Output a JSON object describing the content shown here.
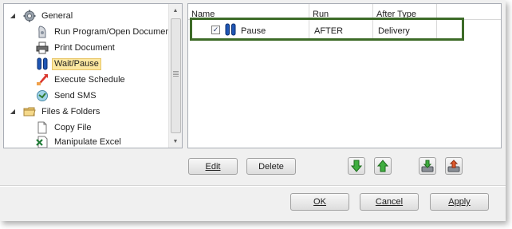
{
  "tree": {
    "items": [
      {
        "label": "General",
        "icon": "gear-icon",
        "expander": "▲"
      },
      {
        "label": "Run Program/Open Document",
        "icon": "run-program-icon"
      },
      {
        "label": "Print Document",
        "icon": "printer-icon"
      },
      {
        "label": "Wait/Pause",
        "icon": "pause-icon",
        "selected": true
      },
      {
        "label": "Execute Schedule",
        "icon": "execute-schedule-icon"
      },
      {
        "label": "Send SMS",
        "icon": "sms-icon"
      },
      {
        "label": "Files & Folders",
        "icon": "folder-icon",
        "expander": "▲"
      },
      {
        "label": "Copy File",
        "icon": "copy-file-icon"
      },
      {
        "label": "Manipulate Excel",
        "icon": "excel-icon"
      }
    ]
  },
  "grid": {
    "columns": [
      "Name",
      "Run",
      "After Type"
    ],
    "rows": [
      {
        "checked": "✓",
        "name": "Pause",
        "run": "AFTER",
        "after_type": "Delivery"
      }
    ],
    "highlight_color": "#3d6b28"
  },
  "actions": {
    "edit_label": "Edit",
    "delete_label": "Delete"
  },
  "footer": {
    "ok_label": "OK",
    "cancel_label": "Cancel",
    "apply_label": "Apply"
  }
}
